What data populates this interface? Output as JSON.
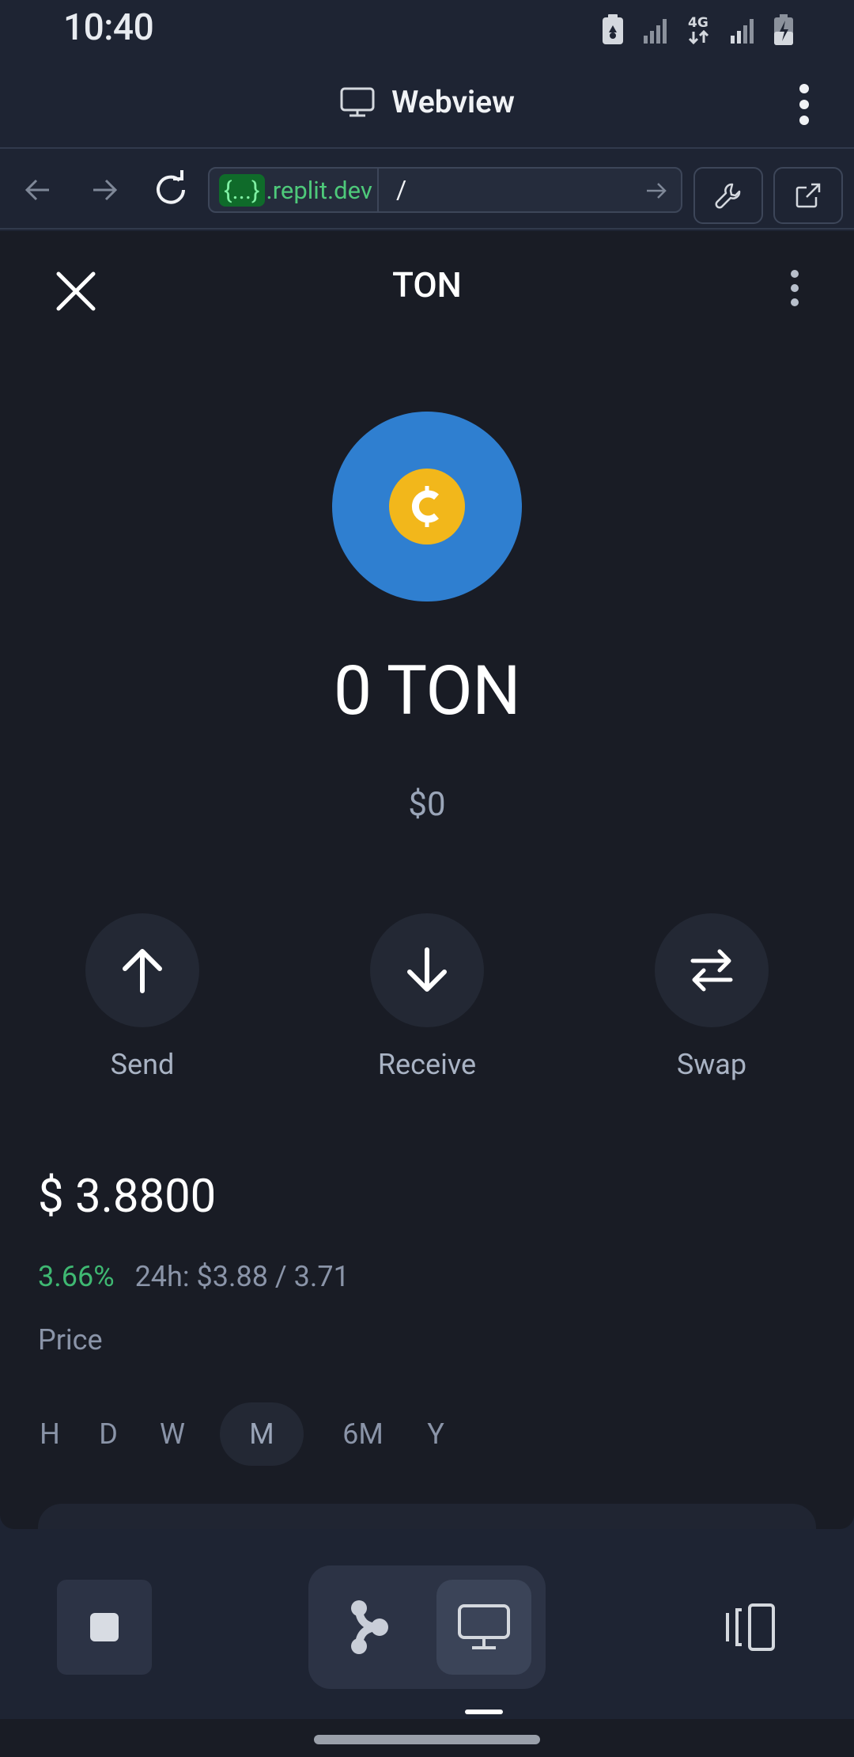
{
  "status_bar": {
    "time": "10:40",
    "network_label": "4G"
  },
  "webview": {
    "title": "Webview",
    "url": {
      "host_mask": "{...}",
      "host_suffix": ".replit.dev",
      "path": "/"
    }
  },
  "app": {
    "title": "TON",
    "balance": "0 TON",
    "fiat_value": "$0",
    "actions": [
      {
        "label": "Send"
      },
      {
        "label": "Receive"
      },
      {
        "label": "Swap"
      }
    ],
    "price": "$ 3.8800",
    "change_percent": "3.66%",
    "range_24h": "24h: $3.88 / 3.71",
    "price_label": "Price",
    "periods": [
      {
        "label": "H",
        "active": false
      },
      {
        "label": "D",
        "active": false
      },
      {
        "label": "W",
        "active": false
      },
      {
        "label": "M",
        "active": true
      },
      {
        "label": "6M",
        "active": false
      },
      {
        "label": "Y",
        "active": false
      }
    ]
  },
  "colors": {
    "background": "#191c25",
    "chrome": "#1e2433",
    "token_blue": "#2f7fd0",
    "coin_gold": "#f2b71b",
    "positive_green": "#3fb872"
  }
}
